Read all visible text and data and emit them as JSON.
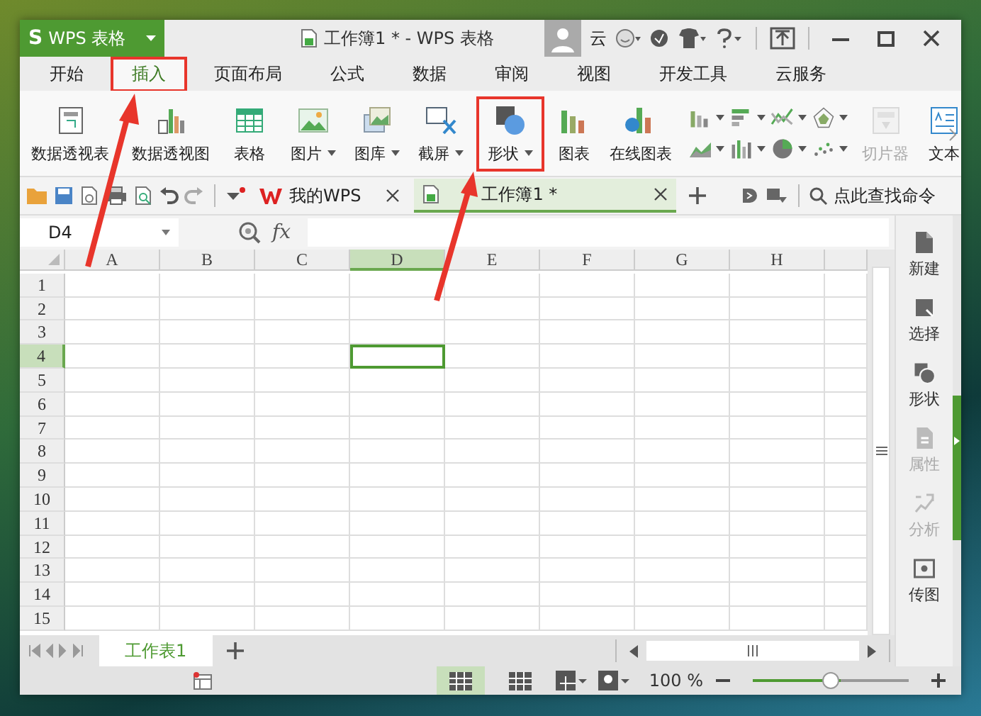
{
  "app": {
    "logo_mark": "S",
    "logo_text": "WPS 表格",
    "title": "工作簿1 * - WPS 表格",
    "user": "云"
  },
  "menu_tabs": [
    {
      "label": "开始",
      "selected": false,
      "annotated": false
    },
    {
      "label": "插入",
      "selected": true,
      "annotated": true
    },
    {
      "label": "页面布局",
      "selected": false,
      "annotated": false
    },
    {
      "label": "公式",
      "selected": false,
      "annotated": false
    },
    {
      "label": "数据",
      "selected": false,
      "annotated": false
    },
    {
      "label": "审阅",
      "selected": false,
      "annotated": false
    },
    {
      "label": "视图",
      "selected": false,
      "annotated": false
    },
    {
      "label": "开发工具",
      "selected": false,
      "annotated": false
    },
    {
      "label": "云服务",
      "selected": false,
      "annotated": false
    }
  ],
  "ribbon": [
    [
      {
        "kind": "large",
        "label": "数据透视表",
        "dropdown": false,
        "disabled": false,
        "annotated": false
      },
      {
        "kind": "large",
        "label": "数据透视图",
        "dropdown": false,
        "disabled": false,
        "annotated": false
      },
      {
        "kind": "large",
        "label": "表格",
        "dropdown": false,
        "disabled": false,
        "annotated": false
      }
    ],
    [
      {
        "kind": "large",
        "label": "图片",
        "dropdown": true,
        "disabled": false,
        "annotated": false
      },
      {
        "kind": "large",
        "label": "图库",
        "dropdown": true,
        "disabled": false,
        "annotated": false
      },
      {
        "kind": "large",
        "label": "截屏",
        "dropdown": true,
        "disabled": false,
        "annotated": false
      },
      {
        "kind": "large",
        "label": "形状",
        "dropdown": true,
        "disabled": false,
        "annotated": true
      },
      {
        "kind": "large",
        "label": "图表",
        "dropdown": false,
        "disabled": false,
        "annotated": false
      },
      {
        "kind": "large",
        "label": "在线图表",
        "dropdown": false,
        "disabled": false,
        "annotated": false
      },
      {
        "kind": "small",
        "dropdown": true,
        "disabled": false,
        "annotated": false
      },
      {
        "kind": "small",
        "dropdown": true,
        "disabled": false,
        "annotated": false
      },
      {
        "kind": "small",
        "dropdown": true,
        "disabled": false,
        "annotated": false
      },
      {
        "kind": "small",
        "dropdown": true,
        "disabled": false,
        "annotated": false
      },
      {
        "kind": "small",
        "dropdown": true,
        "disabled": false,
        "annotated": false
      },
      {
        "kind": "small",
        "dropdown": true,
        "disabled": false,
        "annotated": false
      },
      {
        "kind": "small",
        "dropdown": true,
        "disabled": false,
        "annotated": false
      },
      {
        "kind": "small",
        "dropdown": true,
        "disabled": false,
        "annotated": false
      }
    ],
    [
      {
        "kind": "large",
        "label": "切片器",
        "dropdown": false,
        "disabled": true,
        "annotated": false
      },
      {
        "kind": "large",
        "label": "文本",
        "dropdown": false,
        "disabled": false,
        "annotated": false
      }
    ]
  ],
  "doc_tabs": [
    {
      "label": "我的WPS",
      "selected": false
    },
    {
      "label": "工作簿1 *",
      "selected": true
    }
  ],
  "search": {
    "placeholder": "点此查找命令"
  },
  "formula_bar": {
    "name_box": "D4",
    "fx": "fx"
  },
  "columns": [
    {
      "label": "A",
      "selected": false
    },
    {
      "label": "B",
      "selected": false
    },
    {
      "label": "C",
      "selected": false
    },
    {
      "label": "D",
      "selected": true
    },
    {
      "label": "E",
      "selected": false
    },
    {
      "label": "F",
      "selected": false
    },
    {
      "label": "G",
      "selected": false
    },
    {
      "label": "H",
      "selected": false
    }
  ],
  "rows": [
    {
      "label": "1",
      "selected": false
    },
    {
      "label": "2",
      "selected": false
    },
    {
      "label": "3",
      "selected": false
    },
    {
      "label": "4",
      "selected": true
    },
    {
      "label": "5",
      "selected": false
    },
    {
      "label": "6",
      "selected": false
    },
    {
      "label": "7",
      "selected": false
    },
    {
      "label": "8",
      "selected": false
    },
    {
      "label": "9",
      "selected": false
    },
    {
      "label": "10",
      "selected": false
    },
    {
      "label": "11",
      "selected": false
    },
    {
      "label": "12",
      "selected": false
    },
    {
      "label": "13",
      "selected": false
    },
    {
      "label": "14",
      "selected": false
    },
    {
      "label": "15",
      "selected": false
    }
  ],
  "side_panel": [
    {
      "label": "新建",
      "disabled": false
    },
    {
      "label": "选择",
      "disabled": false
    },
    {
      "label": "形状",
      "disabled": false
    },
    {
      "label": "属性",
      "disabled": true
    },
    {
      "label": "分析",
      "disabled": true
    },
    {
      "label": "传图",
      "disabled": false
    }
  ],
  "sheet_tabs": [
    {
      "label": "工作表1",
      "selected": true
    }
  ],
  "status_bar": {
    "views": [
      {
        "selected": true
      },
      {
        "selected": false
      }
    ],
    "zoom": "100 %",
    "level": 0.5
  }
}
